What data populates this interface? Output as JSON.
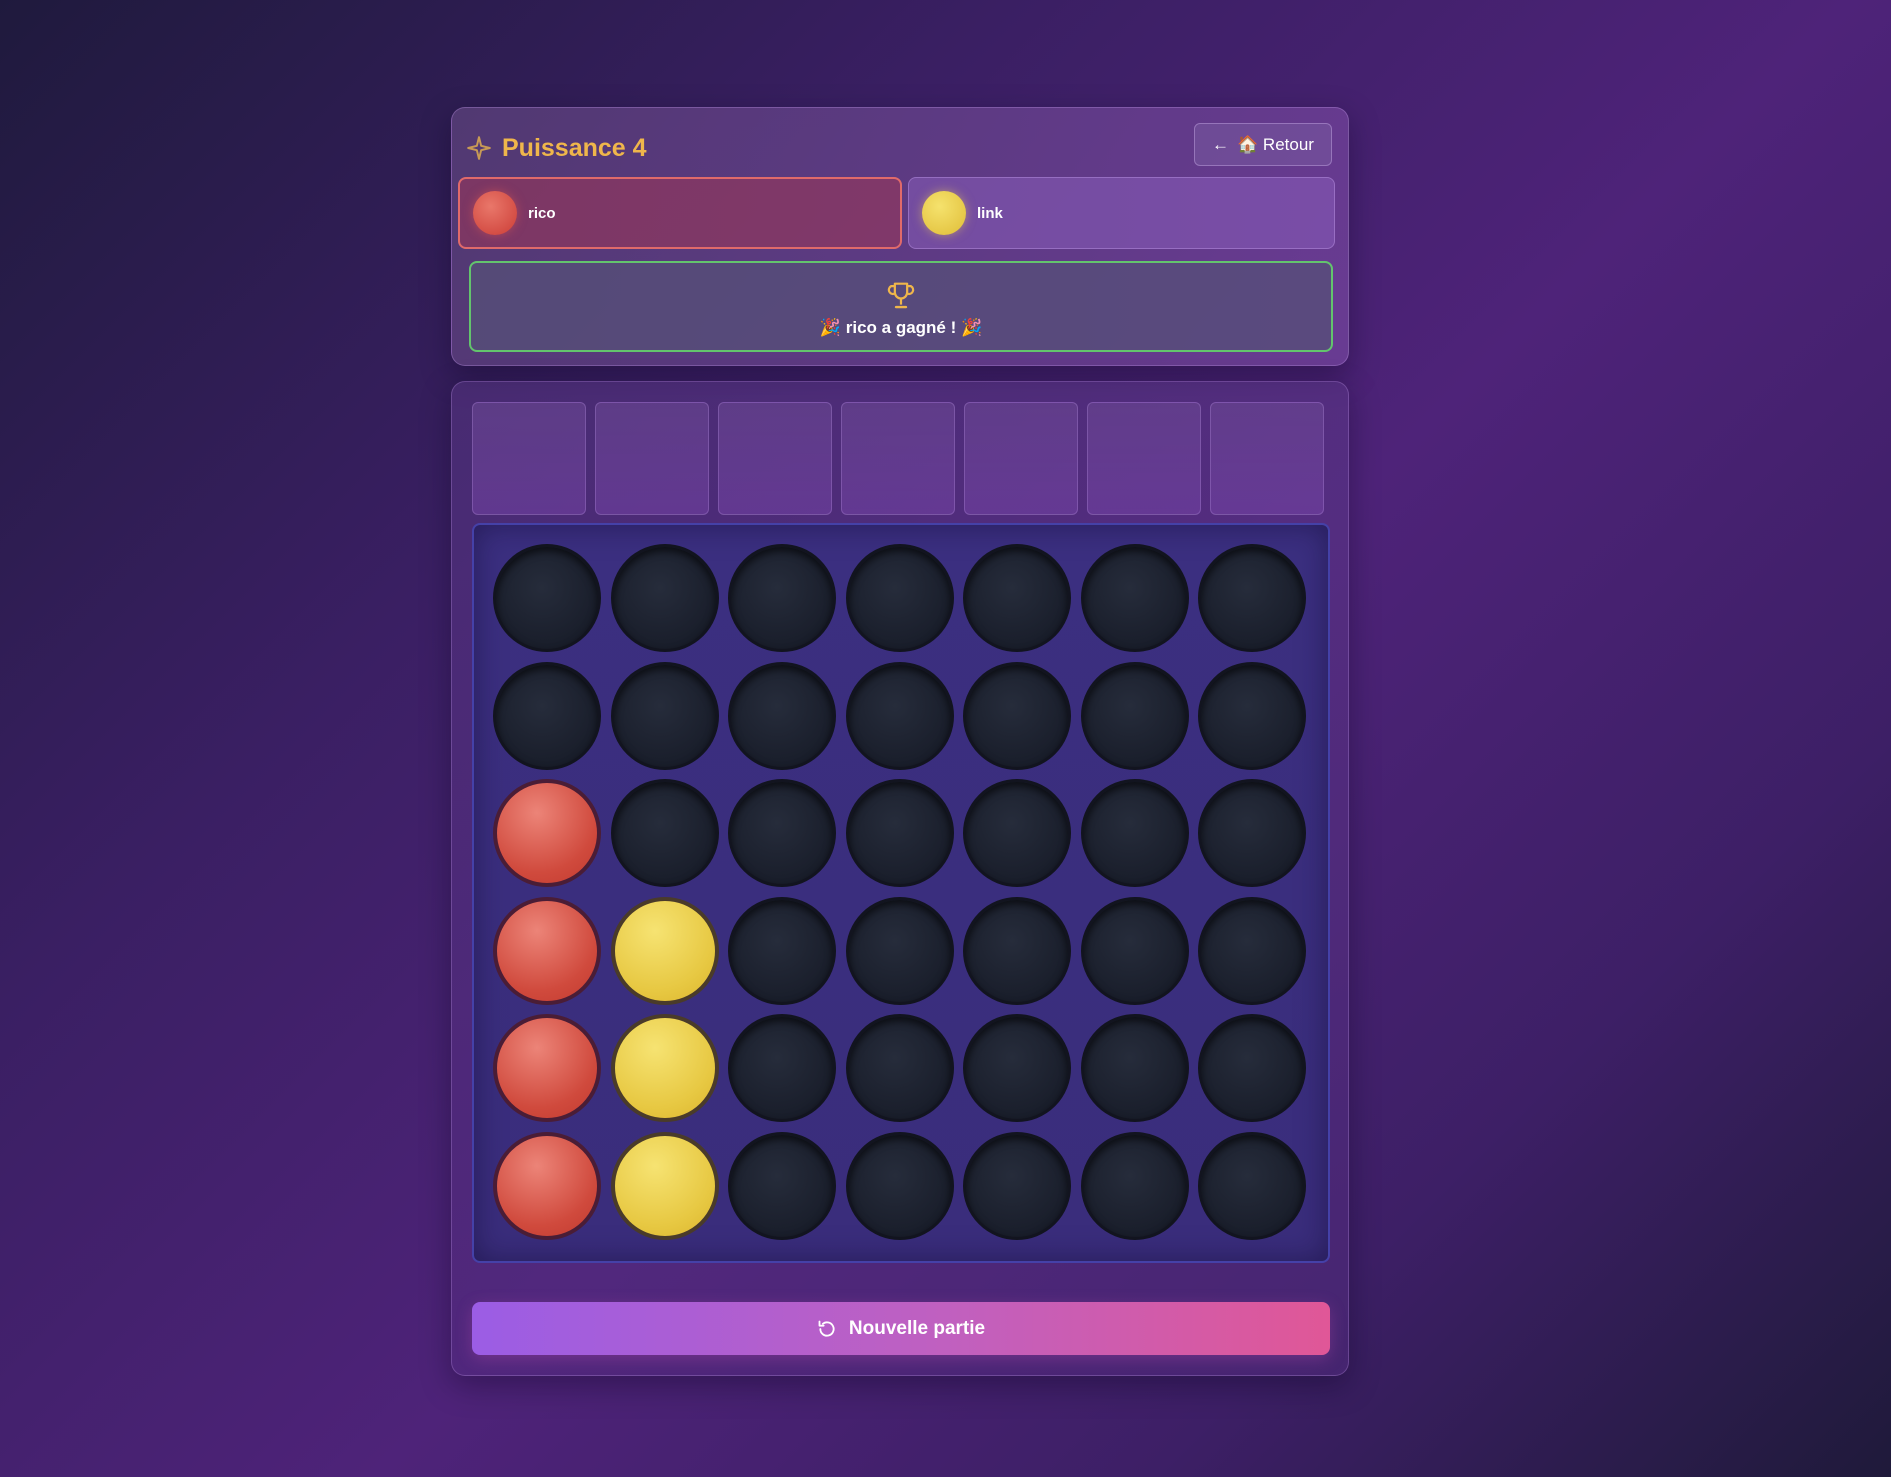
{
  "header": {
    "title": "Puissance 4",
    "back_label": "🏠 Retour"
  },
  "players": [
    {
      "name": "rico",
      "color": "red",
      "active": true
    },
    {
      "name": "link",
      "color": "yellow",
      "active": false
    }
  ],
  "result": {
    "message": "🎉 rico a gagné ! 🎉"
  },
  "board": {
    "columns": 7,
    "rows": 6,
    "cells": [
      [
        "empty",
        "empty",
        "empty",
        "empty",
        "empty",
        "empty",
        "empty"
      ],
      [
        "empty",
        "empty",
        "empty",
        "empty",
        "empty",
        "empty",
        "empty"
      ],
      [
        "red",
        "empty",
        "empty",
        "empty",
        "empty",
        "empty",
        "empty"
      ],
      [
        "red",
        "yellow",
        "empty",
        "empty",
        "empty",
        "empty",
        "empty"
      ],
      [
        "red",
        "yellow",
        "empty",
        "empty",
        "empty",
        "empty",
        "empty"
      ],
      [
        "red",
        "yellow",
        "empty",
        "empty",
        "empty",
        "empty",
        "empty"
      ]
    ]
  },
  "actions": {
    "new_game_label": "Nouvelle partie"
  },
  "colors": {
    "red": "#d04a3d",
    "yellow": "#e7c842",
    "accent": "#efb64b",
    "win_border": "#63c46d"
  },
  "icons": {
    "title": "sparkle-icon",
    "back": "arrow-left-icon",
    "winner": "trophy-icon",
    "new_game": "refresh-icon"
  }
}
